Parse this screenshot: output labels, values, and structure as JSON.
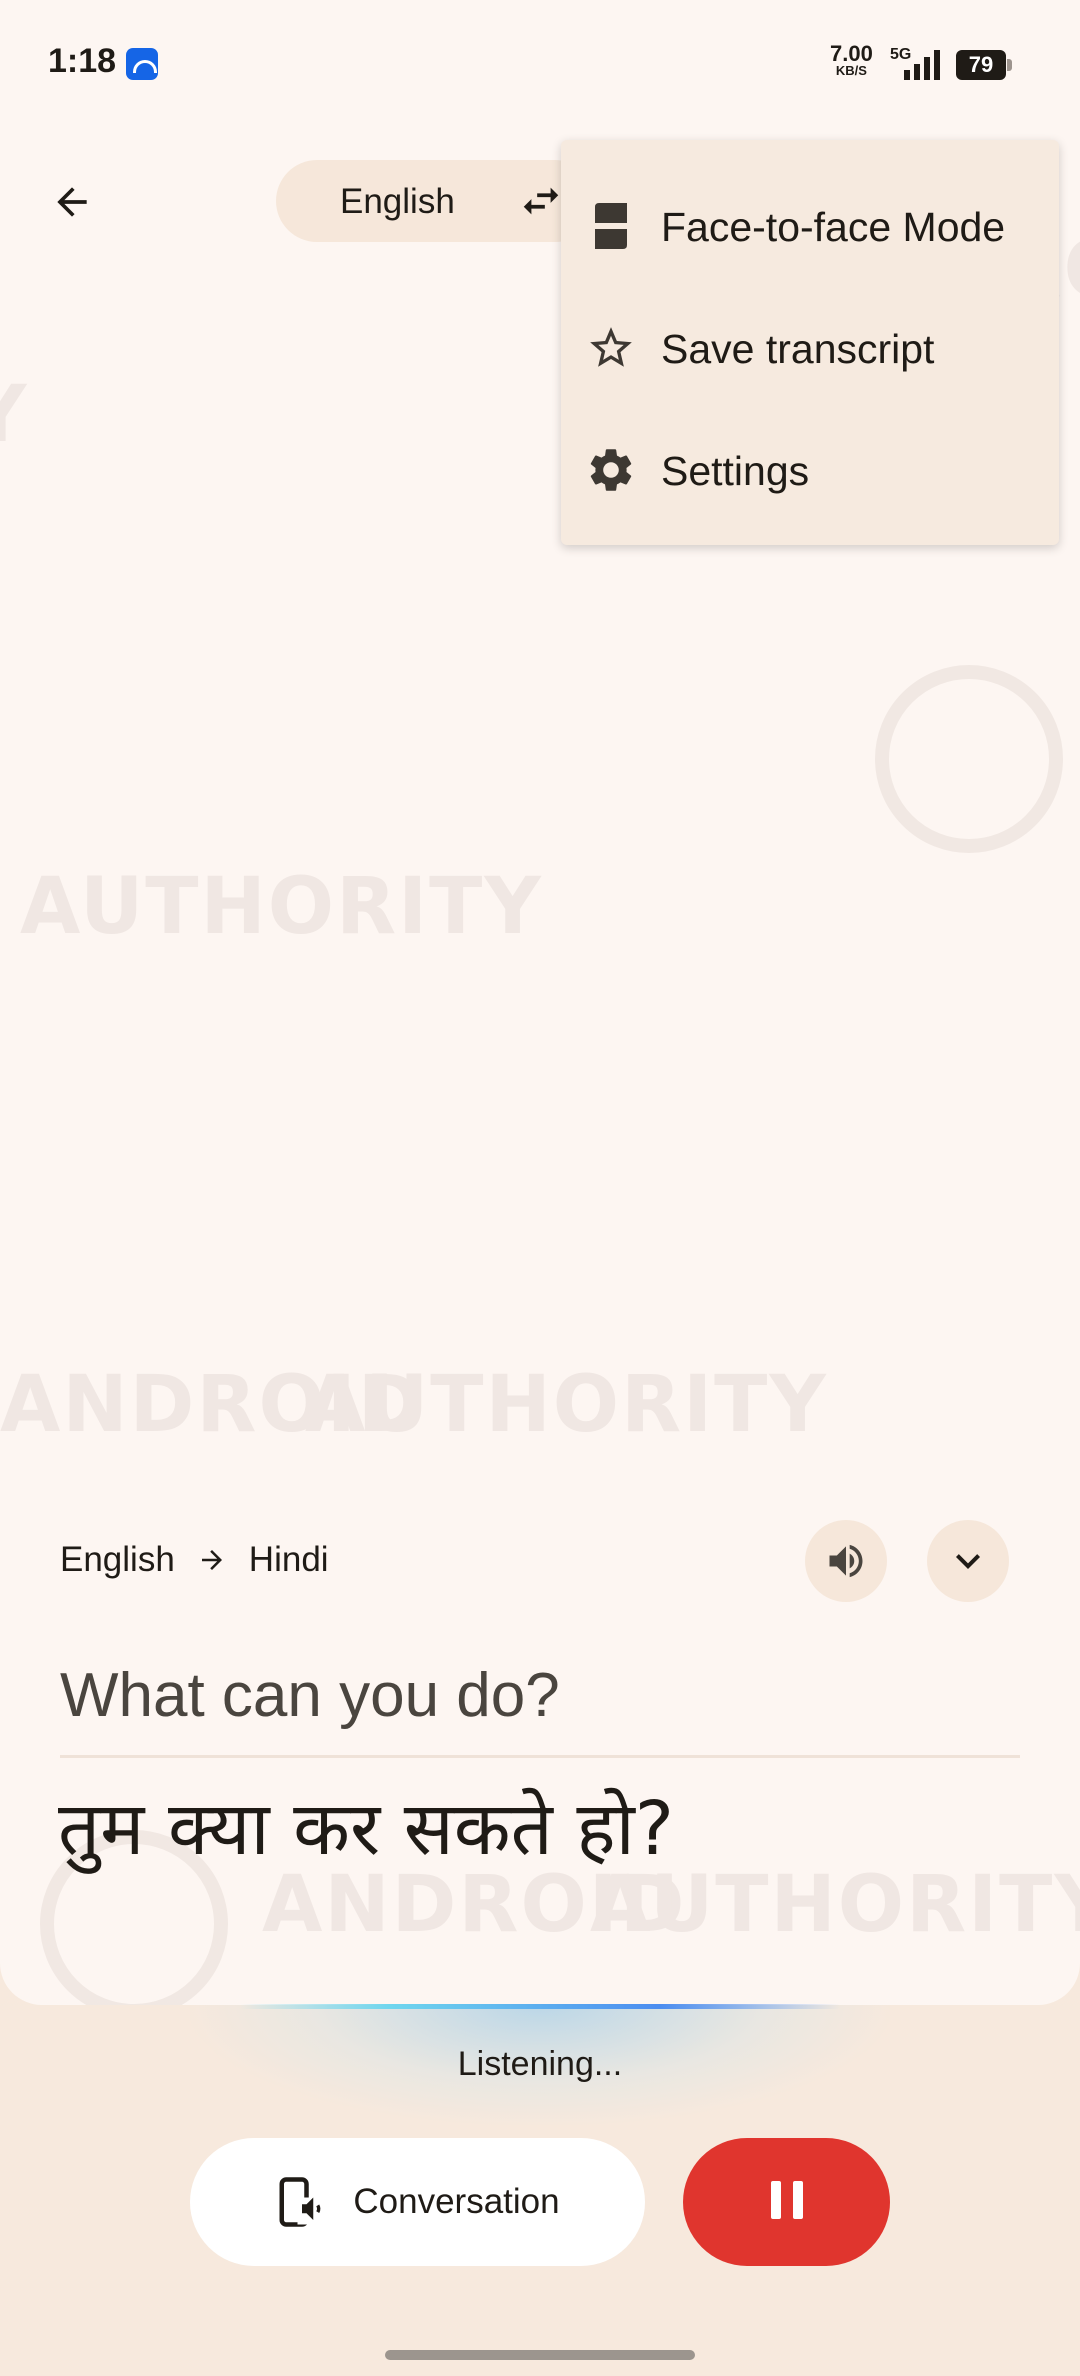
{
  "status_bar": {
    "time": "1:18",
    "speed_value": "7.00",
    "speed_unit": "KB/S",
    "network": "5G",
    "battery": "79"
  },
  "top_bar": {
    "source_language": "English",
    "back_icon": "arrow-left-icon",
    "swap_icon": "swap-arrows-icon"
  },
  "menu": {
    "items": [
      {
        "label": "Face-to-face Mode",
        "icon": "face-to-face-icon"
      },
      {
        "label": "Save transcript",
        "icon": "star-icon"
      },
      {
        "label": "Settings",
        "icon": "gear-icon"
      }
    ]
  },
  "translation": {
    "from": "English",
    "to": "Hindi",
    "source_text": "What can you do?",
    "translated_text": "तुम क्या कर सकते हो?"
  },
  "bottom": {
    "status": "Listening...",
    "conversation_label": "Conversation"
  },
  "watermark": {
    "word1": "ANDROID",
    "word2": "AUTHORITY"
  },
  "colors": {
    "background": "#fdf6f2",
    "surface": "#f6e7da",
    "pause_button": "#e0352e",
    "text": "#1f1b16"
  }
}
